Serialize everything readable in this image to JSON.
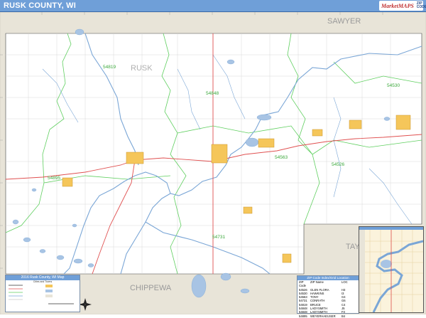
{
  "title": "RUSK COUNTY, WI",
  "logo": {
    "name": "MarketMAPS",
    "badge": "ZIP CODE"
  },
  "map_labels": {
    "county_main": "RUSK",
    "neighbor_north": "SAWYER",
    "neighbor_south": "CHIPPEWA",
    "neighbor_east": "TAYLOR"
  },
  "zip_labels": [
    "54819",
    "54848",
    "54530",
    "54563",
    "54526",
    "54895",
    "54731"
  ],
  "legend": {
    "title": "2016 Rusk County, WI Map",
    "subtitle": "Cities and Towns"
  },
  "zip_table": {
    "title": "ZIP Code Index/Grid Location",
    "headers": [
      "ZIP Code",
      "ZIP Name",
      "LOC"
    ],
    "rows": [
      [
        "54526",
        "GLEN FLORA",
        "H3"
      ],
      [
        "54530",
        "HAWKINS",
        "I3"
      ],
      [
        "54563",
        "TONY",
        "G4"
      ],
      [
        "54731",
        "CONRATH",
        "G6"
      ],
      [
        "54819",
        "BRUCE",
        "C4"
      ],
      [
        "54848",
        "LADYSMITH",
        "J5"
      ],
      [
        "54848",
        "LADYSMITH",
        "F3"
      ],
      [
        "54895",
        "WEYERHAEUSER",
        "B4"
      ]
    ]
  },
  "colors": {
    "title_bar": "#6f9fd8",
    "county_fill": "#ffffff",
    "outside_fill": "#e8e4d8",
    "water": "#a8c4e4",
    "zip_boundary": "#5fcf5f",
    "highway": "#e05050",
    "city_fill": "#f5c65a"
  }
}
